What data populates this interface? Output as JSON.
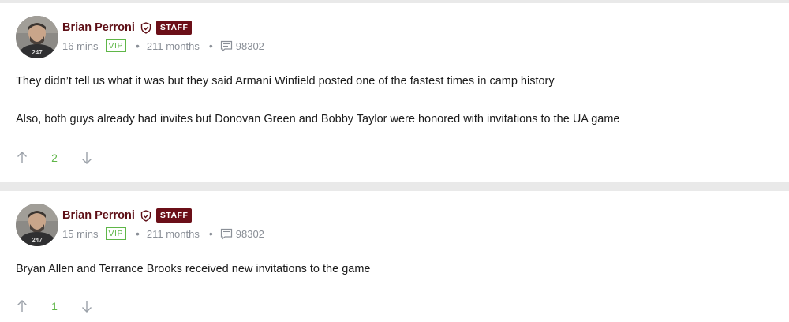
{
  "posts": [
    {
      "author": "Brian Perroni",
      "staff_label": "STAFF",
      "time": "16 mins",
      "vip_label": "VIP",
      "tenure": "211 months",
      "post_count": "98302",
      "paragraphs": [
        "They didn’t tell us what it was but they said Armani Winfield posted one of the fastest times in camp history",
        "Also, both guys already had invites but Donovan Green and Bobby Taylor were honored with invitations to the UA game"
      ],
      "votes": "2"
    },
    {
      "author": "Brian Perroni",
      "staff_label": "STAFF",
      "time": "15 mins",
      "vip_label": "VIP",
      "tenure": "211 months",
      "post_count": "98302",
      "paragraphs": [
        "Bryan Allen and Terrance Brooks received new invitations to the game"
      ],
      "votes": "1"
    }
  ],
  "separator": "•",
  "colors": {
    "author": "#5e0f16",
    "staff_badge": "#6b0f18",
    "vip_green": "#5fb648",
    "meta_gray": "#8a8f97",
    "background": "#e9e9e9"
  },
  "icons": {
    "staff_shield": "shield-icon",
    "post_count": "chat-bubble-icon",
    "upvote": "arrow-up-icon",
    "downvote": "arrow-down-icon"
  }
}
